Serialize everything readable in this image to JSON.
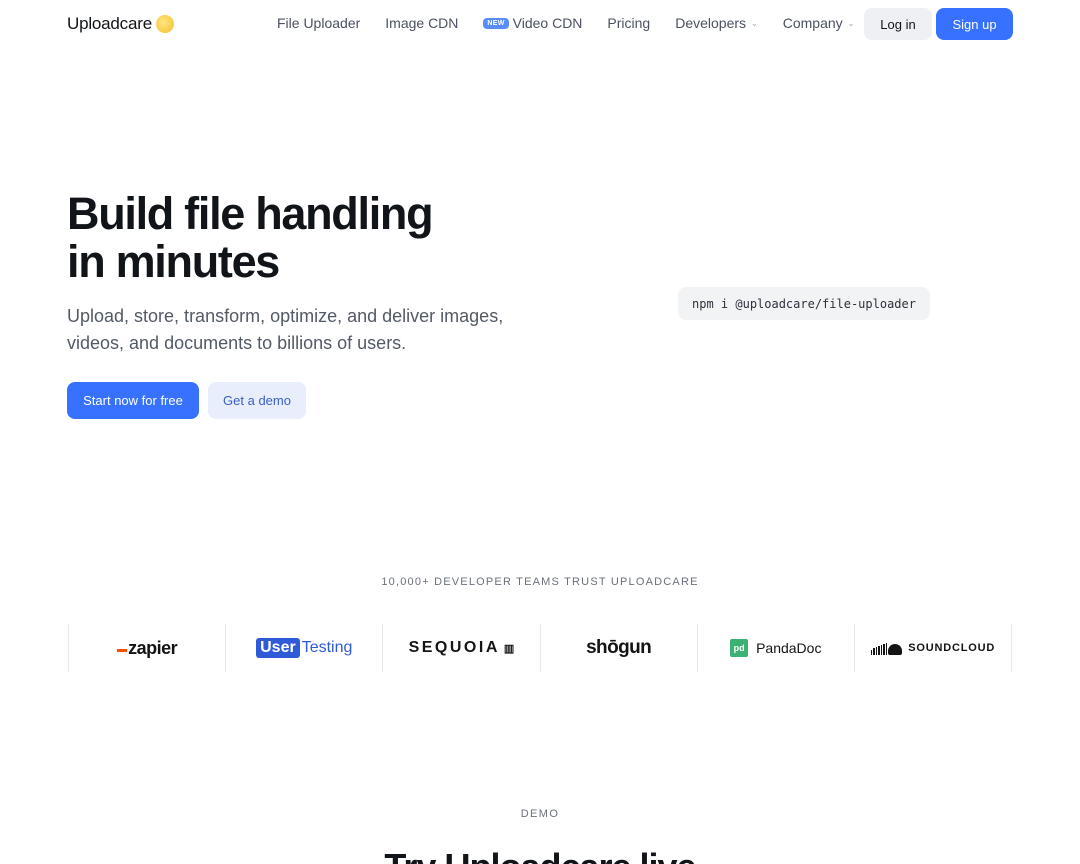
{
  "header": {
    "logo_text": "Uploadcare",
    "nav": [
      {
        "label": "File Uploader",
        "has_dropdown": false,
        "badge": ""
      },
      {
        "label": "Image CDN",
        "has_dropdown": false,
        "badge": ""
      },
      {
        "label": "Video CDN",
        "has_dropdown": false,
        "badge": "NEW"
      },
      {
        "label": "Pricing",
        "has_dropdown": false,
        "badge": ""
      },
      {
        "label": "Developers",
        "has_dropdown": true,
        "badge": ""
      },
      {
        "label": "Company",
        "has_dropdown": true,
        "badge": ""
      }
    ],
    "login_label": "Log in",
    "signup_label": "Sign up"
  },
  "hero": {
    "title_line1": "Build file handling",
    "title_line2": "in minutes",
    "subtitle": "Upload, store, transform, optimize, and deliver images, videos, and documents to billions of users.",
    "primary_cta": "Start now for free",
    "secondary_cta": "Get a demo",
    "install_command": "npm i @uploadcare/file-uploader"
  },
  "trust": {
    "heading": "10,000+ DEVELOPER TEAMS TRUST UPLOADCARE",
    "logos": {
      "zapier": "zapier",
      "usertesting_box": "User",
      "usertesting_text": "Testing",
      "sequoia": "SEQUOIA",
      "shogun": "shōgun",
      "pandadoc_mark": "pd",
      "pandadoc": "PandaDoc",
      "soundcloud": "SOUNDCLOUD"
    }
  },
  "demo": {
    "label": "DEMO",
    "title": "Try Uploadcare live"
  },
  "colors": {
    "accent": "#3771ff",
    "logo_dot": "#f7c948",
    "zapier_orange": "#ff4a00",
    "usertesting_blue": "#2f5bd6",
    "pandadoc_green": "#3bb273"
  }
}
